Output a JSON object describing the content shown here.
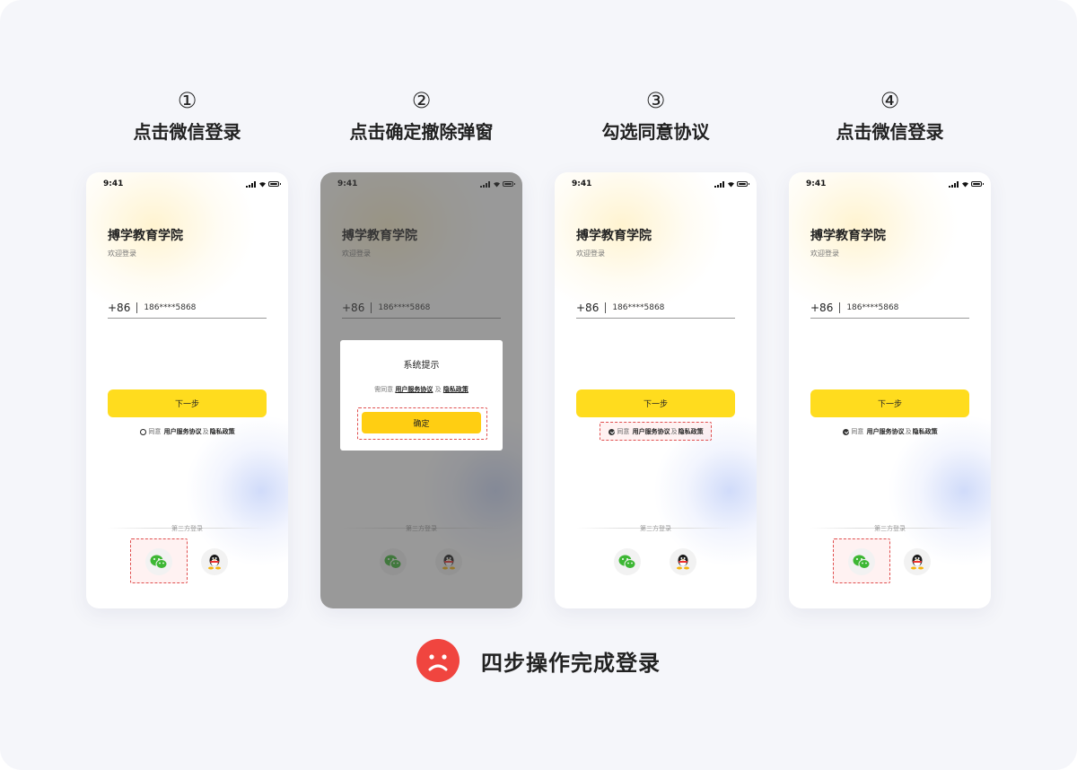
{
  "colors": {
    "accent_yellow": "#ffdc1e",
    "highlight_red": "#e04f4f",
    "sad_face_red": "#f0453f",
    "background": "#f5f6fa"
  },
  "phone_common": {
    "status_time": "9:41",
    "app_title": "搏学教育学院",
    "app_subtitle": "欢迎登录",
    "country_code": "+86",
    "phone_number": "186****5868",
    "next_button": "下一步",
    "agree_prefix": "同意",
    "agreement_link": "用户服务协议",
    "agree_and": "及",
    "privacy_link": "隐私政策",
    "third_party_label": "第三方登录",
    "wechat_icon": "wechat-icon",
    "qq_icon": "qq-penguin-icon"
  },
  "steps": [
    {
      "number": "①",
      "title": "点击微信登录",
      "agreement_checked": false,
      "highlight": "wechat-login"
    },
    {
      "number": "②",
      "title": "点击确定撤除弹窗",
      "agreement_checked": false,
      "highlight": "dialog-confirm"
    },
    {
      "number": "③",
      "title": "勾选同意协议",
      "agreement_checked": true,
      "highlight": "agreement"
    },
    {
      "number": "④",
      "title": "点击微信登录",
      "agreement_checked": true,
      "highlight": "wechat-login"
    }
  ],
  "dialog": {
    "title": "系统提示",
    "text_prefix": "需同意",
    "agreement_link": "用户服务协议",
    "and": "及",
    "privacy_link": "隐私政策",
    "confirm_button": "确定"
  },
  "result": {
    "icon": "sad-face-icon",
    "text": "四步操作完成登录"
  }
}
